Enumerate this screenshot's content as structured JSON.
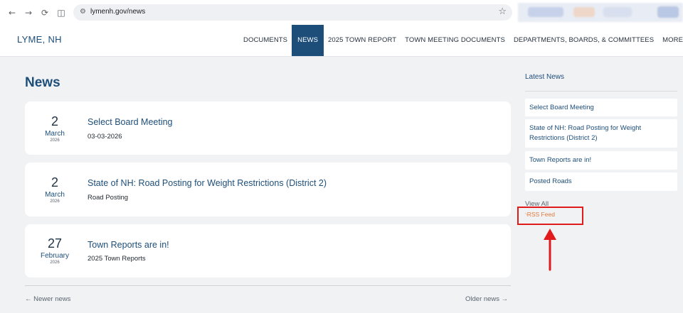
{
  "browser": {
    "url": "lymenh.gov/news",
    "nav_back": "←",
    "nav_forward": "→",
    "nav_reload": "⟳",
    "nav_split": "◫",
    "tune_icon": "⚙",
    "bookmark_icon": "☆"
  },
  "site": {
    "logo": "LYME, NH",
    "nav": [
      {
        "label": "DOCUMENTS",
        "active": false
      },
      {
        "label": "NEWS",
        "active": true
      },
      {
        "label": "2025 TOWN REPORT",
        "active": false
      },
      {
        "label": "TOWN MEETING DOCUMENTS",
        "active": false
      },
      {
        "label": "DEPARTMENTS, BOARDS, & COMMITTEES",
        "active": false
      },
      {
        "label": "MORE ▾",
        "active": false
      }
    ]
  },
  "main": {
    "title": "News",
    "items": [
      {
        "day": "2",
        "month": "March",
        "year": "2026",
        "title": "Select Board Meeting",
        "subtitle": "03-03-2026"
      },
      {
        "day": "2",
        "month": "March",
        "year": "2026",
        "title": "State of NH: Road Posting for Weight Restrictions (District 2)",
        "subtitle": "Road Posting"
      },
      {
        "day": "27",
        "month": "February",
        "year": "2026",
        "title": "Town Reports are in!",
        "subtitle": "2025 Town Reports"
      }
    ],
    "pager": {
      "newer": "← Newer news",
      "older": "Older news →"
    }
  },
  "sidebar": {
    "title": "Latest News",
    "items": [
      "Select Board Meeting",
      "State of NH: Road Posting for Weight Restrictions (District 2)",
      "Town Reports are in!",
      "Posted Roads"
    ],
    "view_all": "View All",
    "rss_label": "RSS Feed",
    "rss_icon": "rss-icon"
  },
  "annotation": {
    "box_color": "#e11b1b",
    "arrow_color": "#e11b1b"
  },
  "colors": {
    "brand": "#1d4e7a",
    "background": "#f1f2f4",
    "rss": "#e07a3a"
  }
}
